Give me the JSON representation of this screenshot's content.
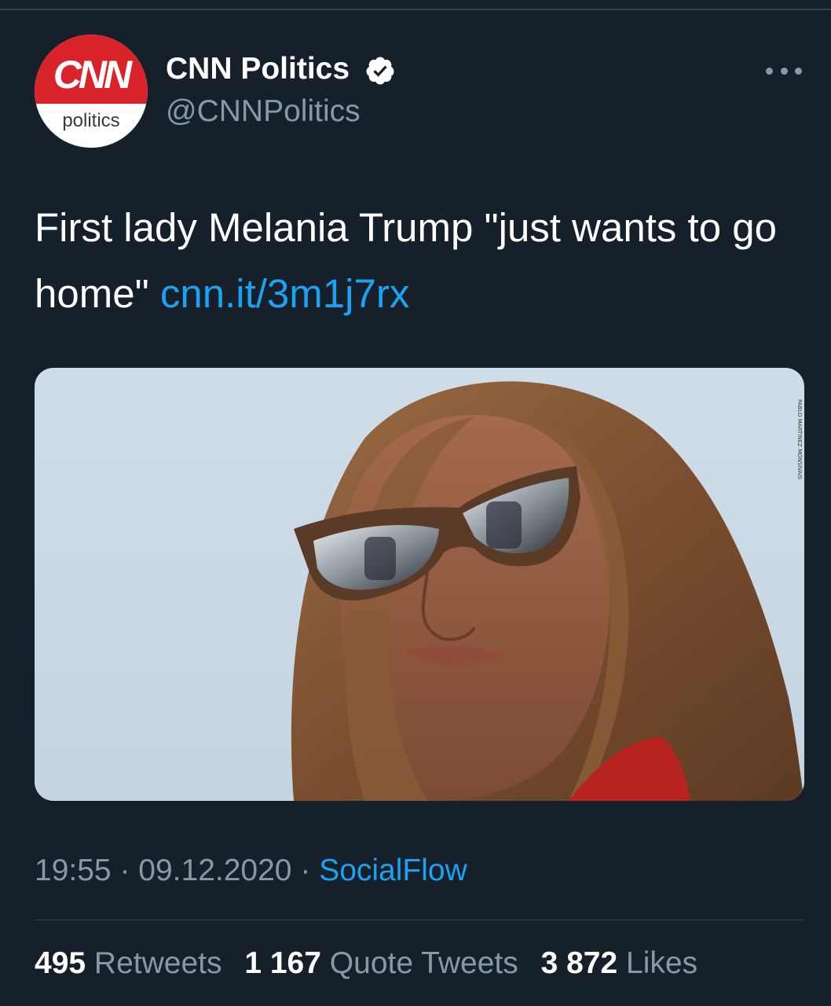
{
  "account": {
    "display_name": "CNN Politics",
    "handle": "@CNNPolitics",
    "verified_icon": "verified-badge-icon",
    "avatar": {
      "brand": "CNN",
      "sub": "politics",
      "brand_color": "#d8232a"
    },
    "more_icon": "more-options-icon"
  },
  "tweet": {
    "text": "First lady Melania Trump \"just wants to go home\"",
    "link": "cnn.it/3m1j7rx",
    "media_credit": "PABLO MARTINEZ MONSIVAIS"
  },
  "meta": {
    "time": "19:55",
    "separator": "·",
    "date": "09.12.2020",
    "source": "SocialFlow"
  },
  "stats": {
    "retweets_count": "495",
    "retweets_label": "Retweets",
    "quotes_count": "1 167",
    "quotes_label": "Quote Tweets",
    "likes_count": "3 872",
    "likes_label": "Likes"
  },
  "colors": {
    "background": "#15202b",
    "link": "#1da1f2",
    "secondary_text": "#8899a6"
  }
}
